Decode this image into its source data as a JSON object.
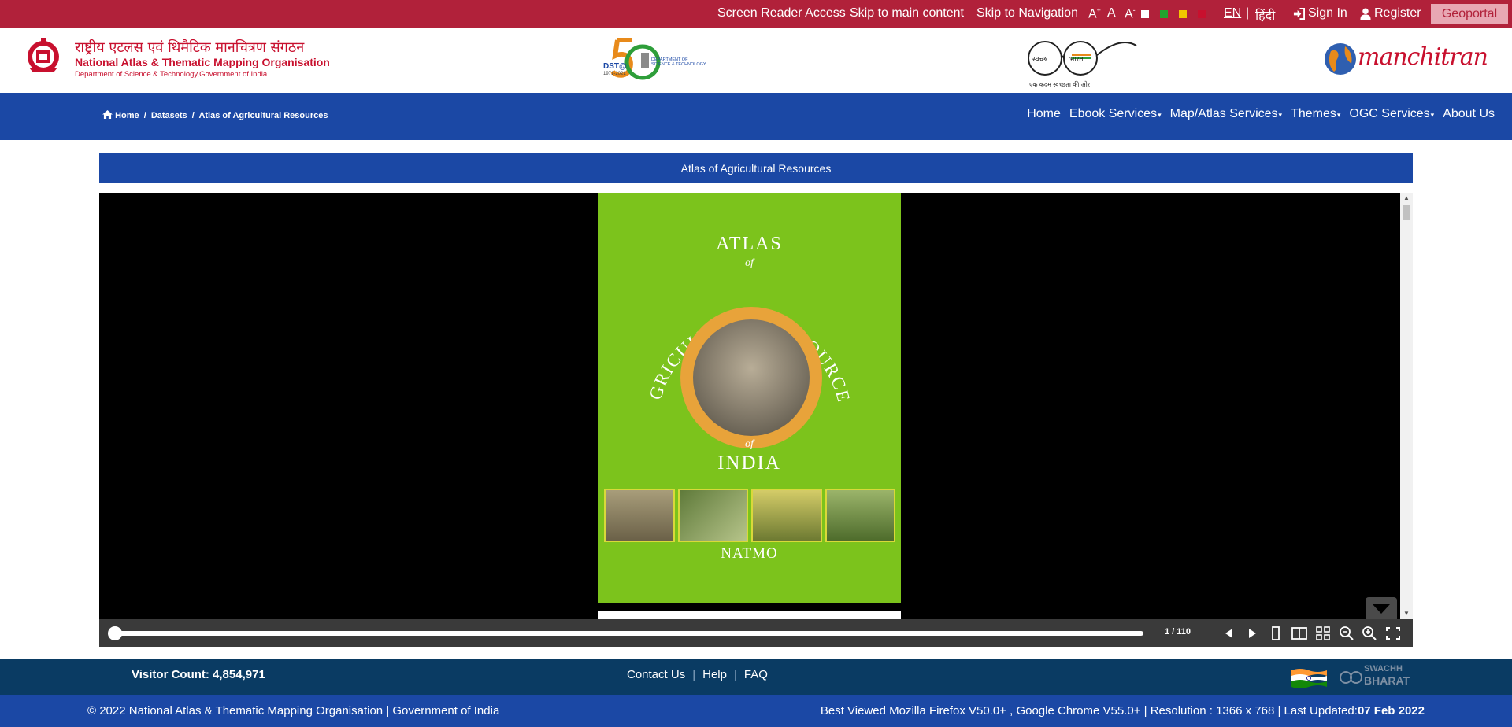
{
  "topbar": {
    "screen_reader": "Screen Reader Access",
    "skip_main": "Skip to main content",
    "skip_nav": "Skip to Navigation",
    "font_increase": "A",
    "font_increase_sup": "+",
    "font_normal": "A",
    "font_decrease": "A",
    "font_decrease_sup": "-",
    "theme_colors": [
      "#ffffff",
      "#22a22e",
      "#f2c500",
      "#c8102e"
    ],
    "lang_en": "EN",
    "lang_sep": "|",
    "lang_hi": "हिंदी",
    "sign_in": "Sign In",
    "register": "Register",
    "geoportal": "Geoportal"
  },
  "header": {
    "org_hindi": "राष्ट्रीय एटलस एवं थिमैटिक मानचित्रण संगठन",
    "org_english": "National Atlas & Thematic Mapping Organisation",
    "org_sub": "Department of Science & Technology,Government of India",
    "dst_logo": {
      "text": "DST@",
      "years": "1971-2021",
      "dept_line1": "DEPARTMENT OF",
      "dept_line2": "SCIENCE & TECHNOLOGY"
    },
    "swachh_logo": {
      "left": "स्वच्छ",
      "right": "भारत",
      "tagline": "एक कदम स्वच्छता की ओर"
    },
    "manchitran_logo": "manchitran"
  },
  "nav": {
    "breadcrumb": [
      "Home",
      "/",
      "Datasets",
      "/",
      "Atlas of Agricultural Resources"
    ],
    "menu": [
      {
        "label": "Home",
        "dropdown": false
      },
      {
        "label": "Ebook Services",
        "dropdown": true
      },
      {
        "label": "Map/Atlas Services",
        "dropdown": true
      },
      {
        "label": "Themes",
        "dropdown": true
      },
      {
        "label": "OGC Services",
        "dropdown": true
      },
      {
        "label": "About Us",
        "dropdown": false
      }
    ]
  },
  "page": {
    "title": "Atlas of Agricultural Resources"
  },
  "viewer": {
    "cover": {
      "atlas": "ATLAS",
      "of1": "of",
      "arc": "AGRICULTURAL RESOURCES",
      "of2": "of",
      "india": "INDIA",
      "publisher": "NATMO",
      "background": "#7cc31c"
    },
    "page_indicator": "1 / 110",
    "progress": 0.0,
    "controls": [
      "prev-page",
      "next-page",
      "single-page-view",
      "double-page-view",
      "thumbnails-view",
      "zoom-out",
      "zoom-in",
      "fullscreen"
    ]
  },
  "footer": {
    "visitor_count": "Visitor Count: 4,854,971",
    "links": [
      "Contact Us",
      "Help",
      "FAQ"
    ],
    "swachh_text1": "SWACHH",
    "swachh_text2": "BHARAT",
    "copyright": "© 2022 National Atlas & Thematic Mapping Organisation | Government of India",
    "best_viewed": "Best Viewed Mozilla Firefox V50.0+ , Google Chrome V55.0+ | Resolution : 1366 x 768 | Last Updated:",
    "last_updated": "07 Feb 2022"
  }
}
